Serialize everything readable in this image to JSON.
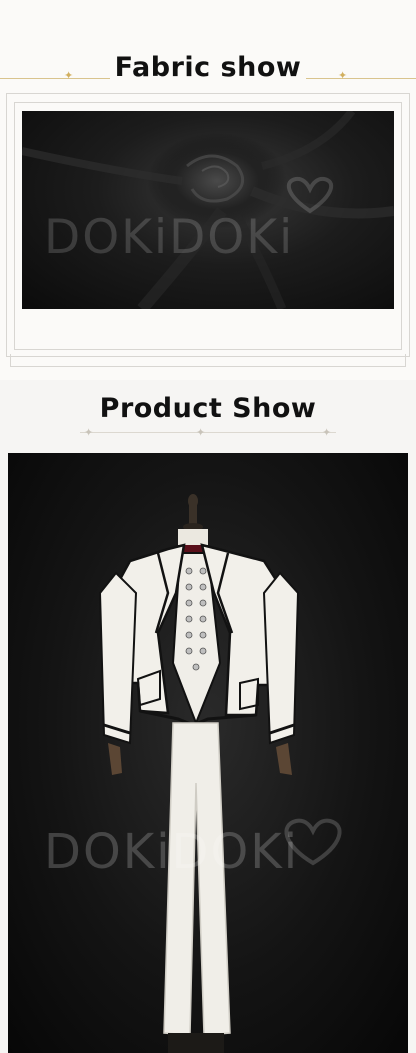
{
  "fabric_section": {
    "title": "Fabric show",
    "watermark": "DOKiDOKi"
  },
  "product_section": {
    "title": "Product Show",
    "watermark": "DOKiDOKi"
  },
  "colors": {
    "gold_accent": "#d2b060",
    "frame_line": "#d8d6d2",
    "fabric": "#1a1a1a",
    "suit": "#f2f0ea",
    "trim": "#121212",
    "shirt": "#5a0f1a"
  }
}
